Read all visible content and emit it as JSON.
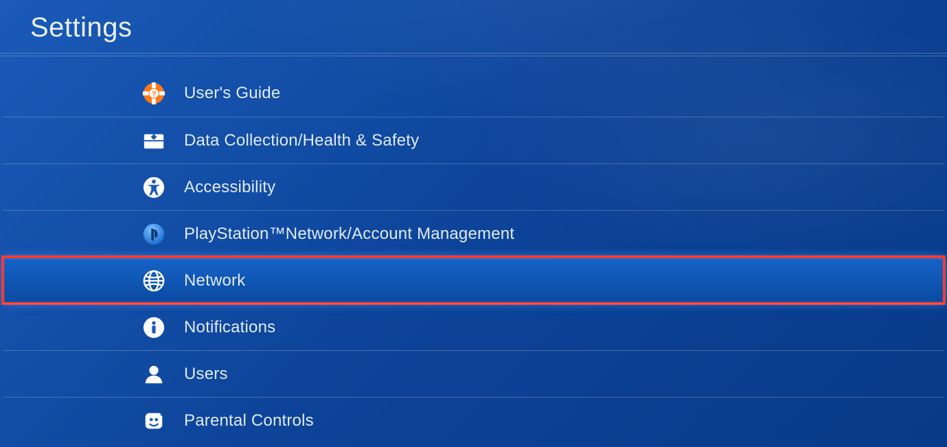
{
  "page_title": "Settings",
  "menu": {
    "items": [
      {
        "label": "User's Guide"
      },
      {
        "label": "Data Collection/Health & Safety"
      },
      {
        "label": "Accessibility"
      },
      {
        "label": "PlayStation™Network/Account Management"
      },
      {
        "label": "Network"
      },
      {
        "label": "Notifications"
      },
      {
        "label": "Users"
      },
      {
        "label": "Parental Controls"
      }
    ],
    "selected_index": 4,
    "highlighted_index": 4
  },
  "colors": {
    "highlight_box": "#ff3b30",
    "background_start": "#1a5ab8",
    "background_end": "#073a88"
  }
}
